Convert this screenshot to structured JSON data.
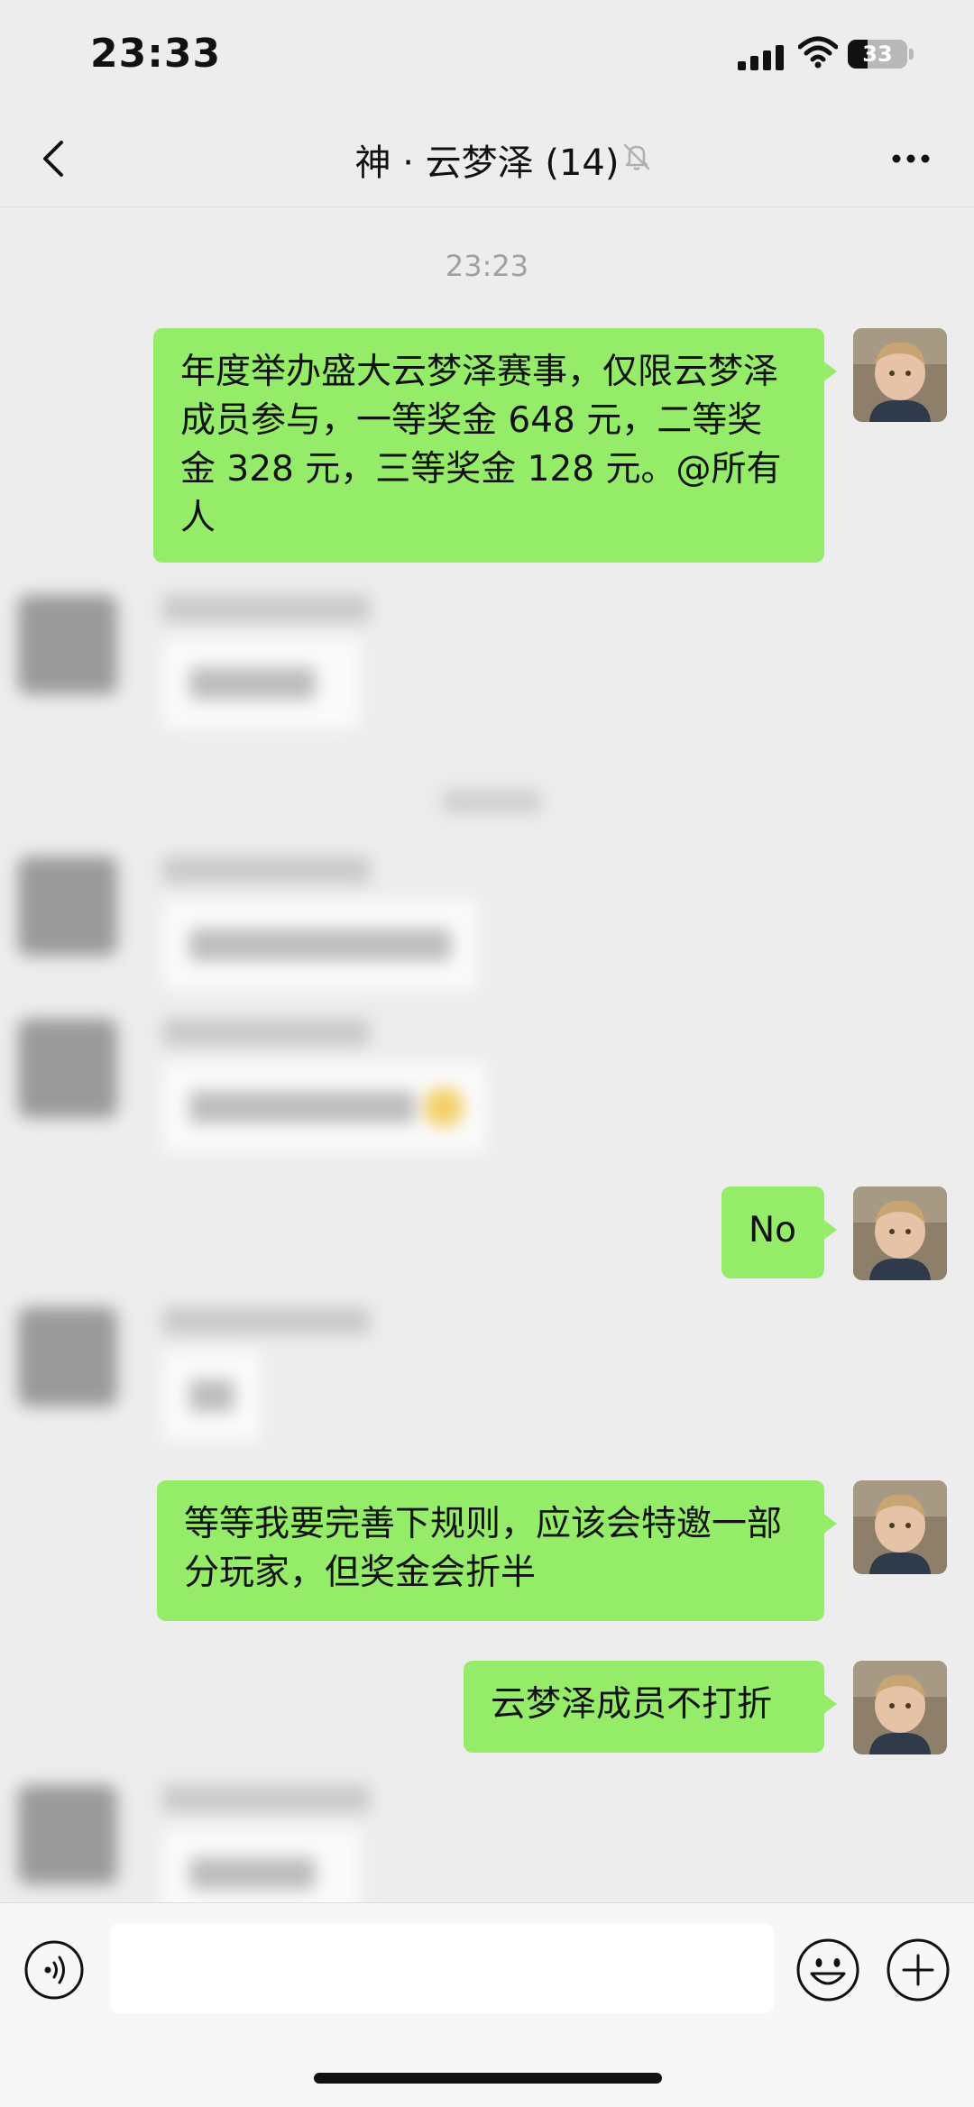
{
  "status_bar": {
    "time": "23:33",
    "battery": "33"
  },
  "nav": {
    "title": "神 · 云梦泽 (14)"
  },
  "chat": {
    "timestamp": "23:23",
    "messages": [
      {
        "text": "年度举办盛大云梦泽赛事，仅限云梦泽成员参与，一等奖金 648 元，二等奖金 328 元，三等奖金 128 元。@所有人"
      },
      {
        "text": "No"
      },
      {
        "text": "等等我要完善下规则，应该会特邀一部分玩家，但奖金会折半"
      },
      {
        "text": "云梦泽成员不打折"
      }
    ]
  },
  "input": {
    "value": ""
  }
}
